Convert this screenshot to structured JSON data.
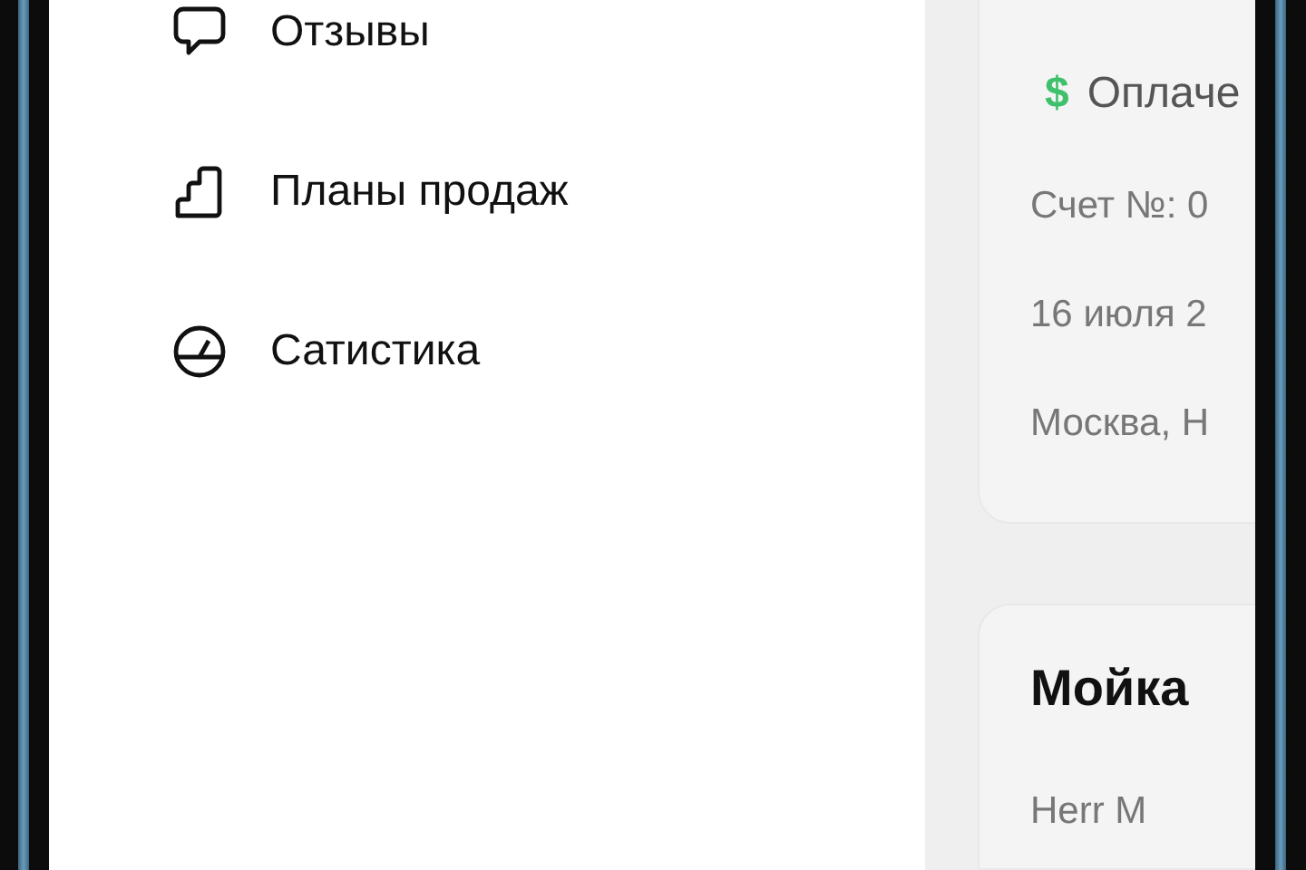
{
  "drawer": {
    "items": [
      {
        "kind": "speech",
        "label": "Отзывы"
      },
      {
        "kind": "steps",
        "label": "Планы продаж"
      },
      {
        "kind": "gauge",
        "label": "Сатистика"
      }
    ]
  },
  "orders": [
    {
      "kind": "details",
      "status": {
        "symbol": "$",
        "text": "Оплаче"
      },
      "lines": [
        "Счет №: 0",
        "16 июля 2",
        "Москва, Н"
      ]
    },
    {
      "kind": "summary",
      "title": "Мойка",
      "lines": [
        "Herr M"
      ]
    }
  ]
}
